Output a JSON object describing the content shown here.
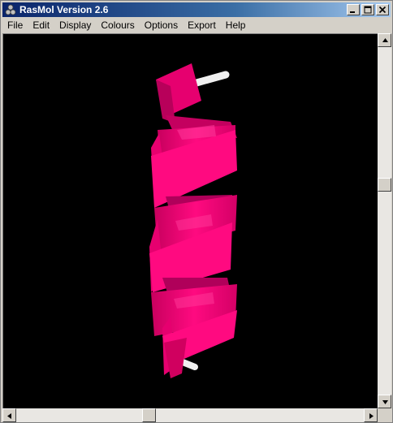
{
  "window": {
    "title": "RasMol Version 2.6",
    "icon": "rasmol-app-icon"
  },
  "title_buttons": {
    "minimize": "minimize-icon",
    "maximize": "maximize-icon",
    "close": "close-icon"
  },
  "menu": {
    "items": [
      "File",
      "Edit",
      "Display",
      "Colours",
      "Options",
      "Export",
      "Help"
    ]
  },
  "viewport": {
    "background": "#000000",
    "molecule_color": "#ff007f",
    "bond_color": "#f0f0f0",
    "representation": "ribbon-helix"
  },
  "scrollbars": {
    "vertical_position": 0.42,
    "horizontal_position": 0.4
  },
  "colors": {
    "titlebar_start": "#0a246a",
    "titlebar_end": "#a6caf0",
    "chrome": "#d4d0c8"
  }
}
